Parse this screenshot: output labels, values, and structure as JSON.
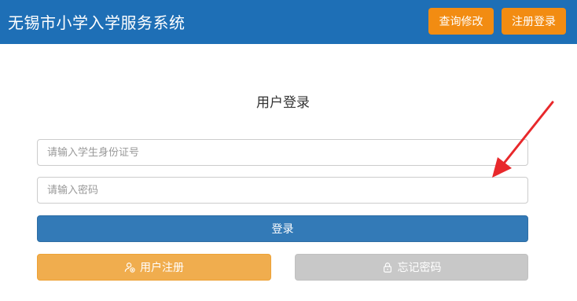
{
  "header": {
    "title": "无锡市小学入学服务系统",
    "query_button": "查询修改",
    "register_button": "注册登录"
  },
  "login": {
    "title": "用户登录",
    "id_placeholder": "请输入学生身份证号",
    "password_placeholder": "请输入密码",
    "login_button": "登录",
    "register_button": "用户注册",
    "forgot_button": "忘记密码"
  },
  "colors": {
    "header_bg": "#1e6fb6",
    "header_button": "#f28c12",
    "primary": "#337ab7",
    "warning": "#f0ad4e",
    "disabled": "#c8c8c8",
    "annotation_arrow": "#e8282b"
  },
  "icons": {
    "register": "user-add-icon",
    "forgot": "lock-icon"
  }
}
